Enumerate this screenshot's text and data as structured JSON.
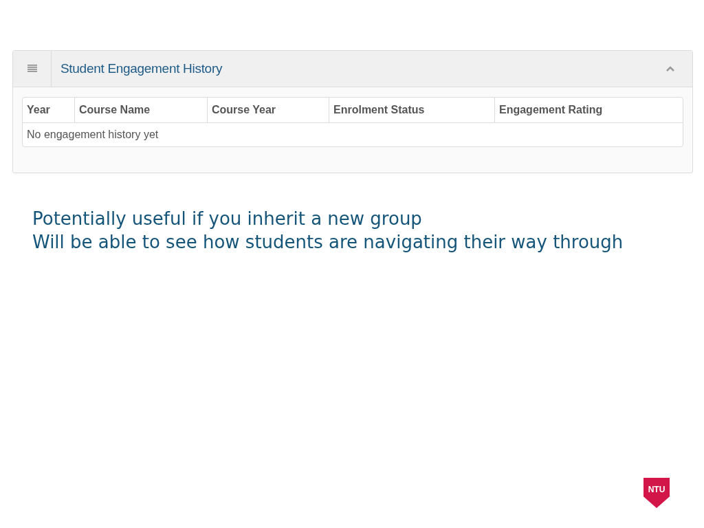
{
  "panel": {
    "title": "Student Engagement History",
    "expanded": true,
    "table": {
      "columns": [
        "Year",
        "Course Name",
        "Course Year",
        "Enrolment Status",
        "Engagement Rating"
      ],
      "empty_message": "No engagement history yet"
    }
  },
  "notes": [
    "Potentially useful if you inherit a new group",
    "Will be able to see how students are navigating their way through"
  ],
  "logo": {
    "text": "NTU"
  }
}
